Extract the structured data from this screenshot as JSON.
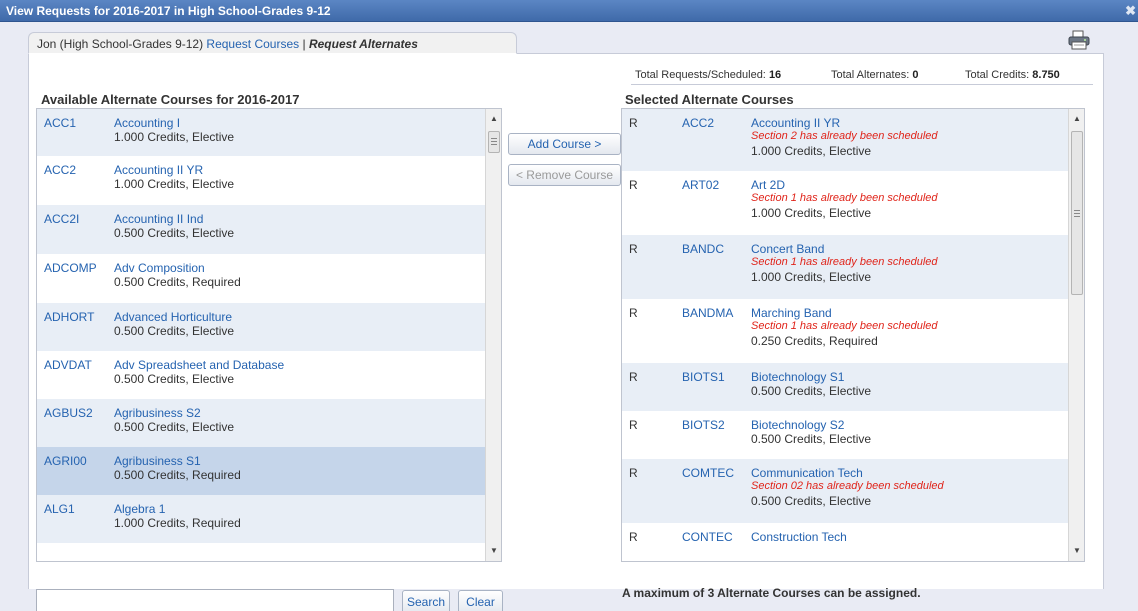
{
  "window": {
    "title": "View Requests for 2016-2017 in High School-Grades 9-12",
    "close_icon": "close-icon"
  },
  "tabs": {
    "student": "Jon (High School-Grades 9-12)",
    "request_courses": "Request Courses",
    "separator": "|",
    "request_alternates": "Request Alternates"
  },
  "totals": {
    "requests_label": "Total Requests/Scheduled:",
    "requests_value": "16",
    "alternates_label": "Total Alternates:",
    "alternates_value": "0",
    "credits_label": "Total Credits:",
    "credits_value": "8.750"
  },
  "available": {
    "title": "Available Alternate Courses for 2016-2017",
    "rows": [
      {
        "code": "ACC1",
        "name": "Accounting I",
        "meta": "1.000 Credits,  Elective"
      },
      {
        "code": "ACC2",
        "name": "Accounting II YR",
        "meta": "1.000 Credits,  Elective"
      },
      {
        "code": "ACC2I",
        "name": "Accounting II Ind",
        "meta": "0.500 Credits,  Elective"
      },
      {
        "code": "ADCOMP",
        "name": "Adv Composition",
        "meta": "0.500 Credits,  Required"
      },
      {
        "code": "ADHORT",
        "name": "Advanced Horticulture",
        "meta": "0.500 Credits,  Elective"
      },
      {
        "code": "ADVDAT",
        "name": "Adv Spreadsheet and Database",
        "meta": "0.500 Credits,  Elective"
      },
      {
        "code": "AGBUS2",
        "name": "Agribusiness S2",
        "meta": "0.500 Credits,  Elective"
      },
      {
        "code": "AGRI00",
        "name": "Agribusiness S1",
        "meta": "0.500 Credits,  Required"
      },
      {
        "code": "ALG1",
        "name": "Algebra 1",
        "meta": "1.000 Credits,  Required"
      }
    ]
  },
  "buttons": {
    "add": "Add Course >",
    "remove": "< Remove Course",
    "search": "Search",
    "clear": "Clear"
  },
  "search": {
    "value": "",
    "placeholder": ""
  },
  "selected": {
    "title": "Selected Alternate Courses",
    "rows": [
      {
        "flag": "R",
        "code": "ACC2",
        "name": "Accounting II YR",
        "warn": "Section 2 has already been scheduled",
        "meta": "1.000 Credits,  Elective"
      },
      {
        "flag": "R",
        "code": "ART02",
        "name": "Art 2D",
        "warn": "Section 1 has already been scheduled",
        "meta": "1.000 Credits,  Elective"
      },
      {
        "flag": "R",
        "code": "BANDC",
        "name": "Concert Band",
        "warn": "Section 1 has already been scheduled",
        "meta": "1.000 Credits,  Elective"
      },
      {
        "flag": "R",
        "code": "BANDMA",
        "name": "Marching Band",
        "warn": "Section 1 has already been scheduled",
        "meta": "0.250 Credits,  Required"
      },
      {
        "flag": "R",
        "code": "BIOTS1",
        "name": "Biotechnology S1",
        "warn": "",
        "meta": "0.500 Credits,  Elective"
      },
      {
        "flag": "R",
        "code": "BIOTS2",
        "name": "Biotechnology S2",
        "warn": "",
        "meta": "0.500 Credits,  Elective"
      },
      {
        "flag": "R",
        "code": "COMTEC",
        "name": "Communication Tech",
        "warn": "Section 02 has already been scheduled",
        "meta": "0.500 Credits,  Elective"
      },
      {
        "flag": "R",
        "code": "CONTEC",
        "name": "Construction Tech",
        "warn": "",
        "meta": ""
      }
    ]
  },
  "footer": {
    "note": "A maximum of 3 Alternate Courses can be assigned."
  }
}
